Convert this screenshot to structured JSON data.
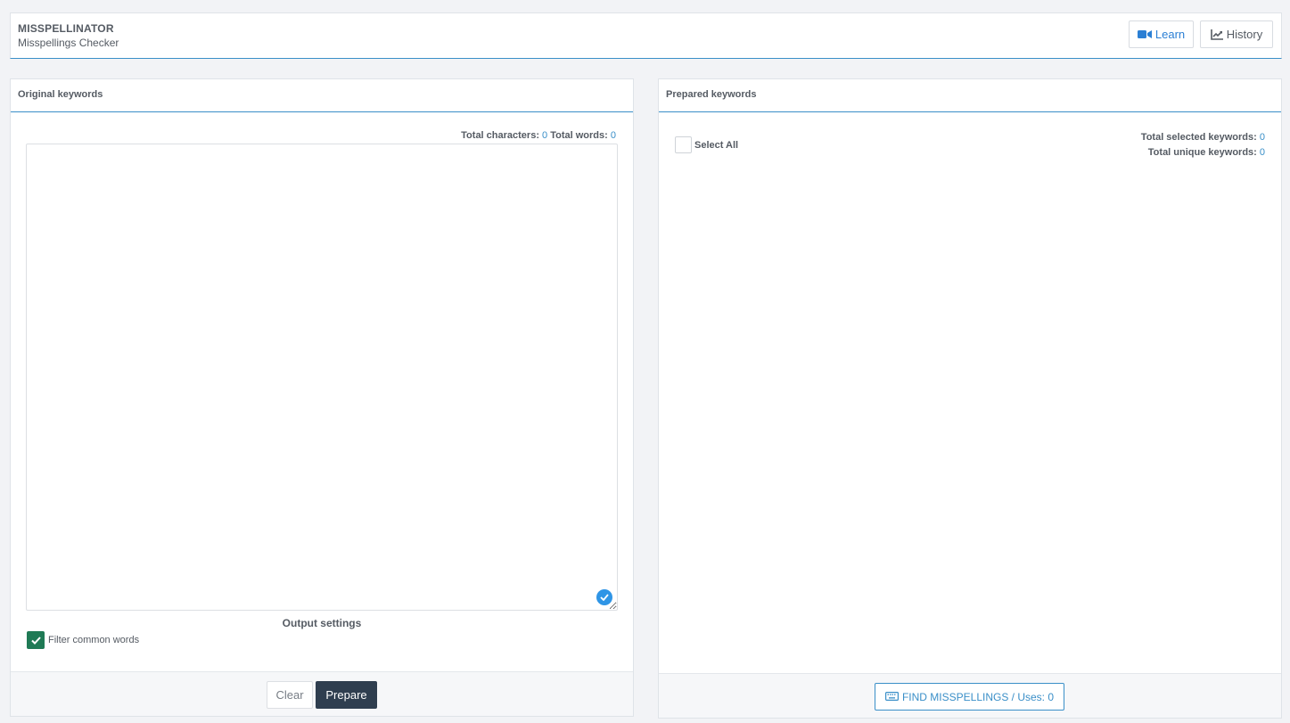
{
  "header": {
    "app_name": "MISSPELLINATOR",
    "app_subtitle": "Misspellings Checker",
    "learn_label": "Learn",
    "history_label": "History"
  },
  "left_panel": {
    "title": "Original keywords",
    "total_characters_label": "Total characters:",
    "total_characters": "0",
    "total_words_label": "Total words:",
    "total_words": "0",
    "textarea_value": "",
    "output_settings_label": "Output settings",
    "filter_common_words_label": "Filter common words",
    "filter_common_words_checked": true,
    "clear_label": "Clear",
    "prepare_label": "Prepare"
  },
  "right_panel": {
    "title": "Prepared keywords",
    "select_all_label": "Select All",
    "total_selected_label": "Total selected keywords:",
    "total_selected": "0",
    "total_unique_label": "Total unique keywords:",
    "total_unique": "0",
    "find_button_label": "FIND MISSPELLINGS / Uses: 0"
  },
  "icons": {
    "learn": "video-camera-icon",
    "history": "line-chart-icon",
    "find": "keyboard-icon",
    "grammar": "check-circle-icon"
  },
  "colors": {
    "accent": "#3a8fc8",
    "link_blue": "#2b7fd4",
    "prepare_button": "#2f3e4f",
    "checkbox_checked": "#1f7a55",
    "background": "#f2f3f6"
  }
}
